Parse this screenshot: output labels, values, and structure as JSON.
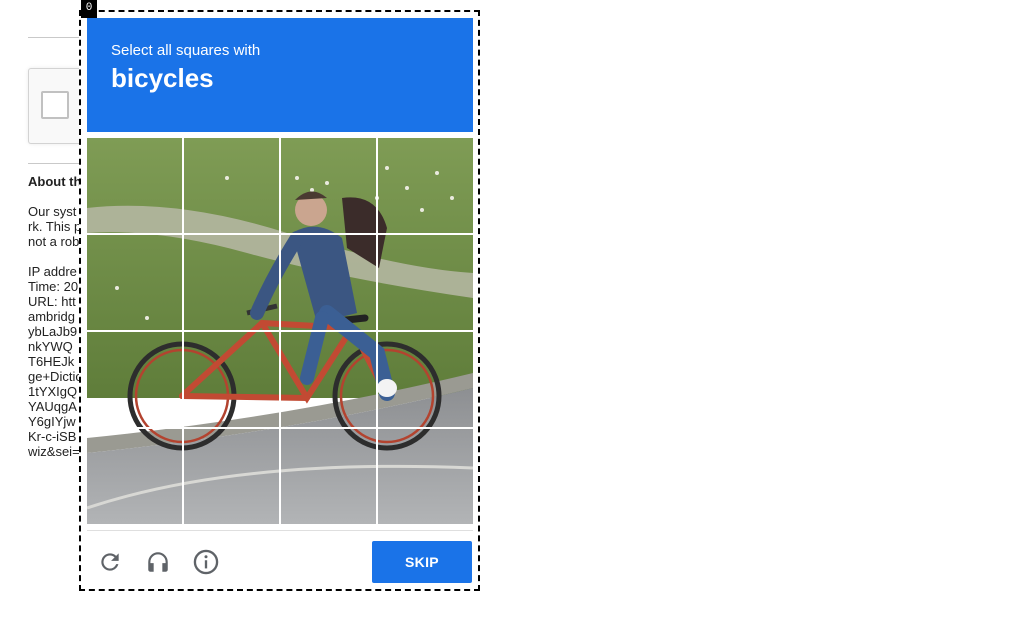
{
  "background_page": {
    "heading": "About th",
    "paragraph1": [
      "Our syst",
      "rk. This p",
      "not a rob"
    ],
    "paragraph2": [
      "IP addre",
      "Time: 20",
      "URL: htt",
      "ambridg",
      "ybLaJb9",
      "nkYWQ",
      "T6HEJk",
      "ge+Dictio",
      "1tYXIgQ",
      "YAUqgA",
      "Y6gIYjw",
      "Kr-c-iSB",
      "wiz&sei="
    ]
  },
  "frame_badge": "0",
  "challenge": {
    "prompt": "Select all squares with",
    "target": "bicycles",
    "grid": {
      "rows": 4,
      "cols": 4
    }
  },
  "footer": {
    "reload_icon": "reload-icon",
    "audio_icon": "headphones-icon",
    "info_icon": "info-icon",
    "skip_label": "SKIP"
  },
  "colors": {
    "accent": "#1a73e8",
    "icon_gray": "#5f6368"
  }
}
